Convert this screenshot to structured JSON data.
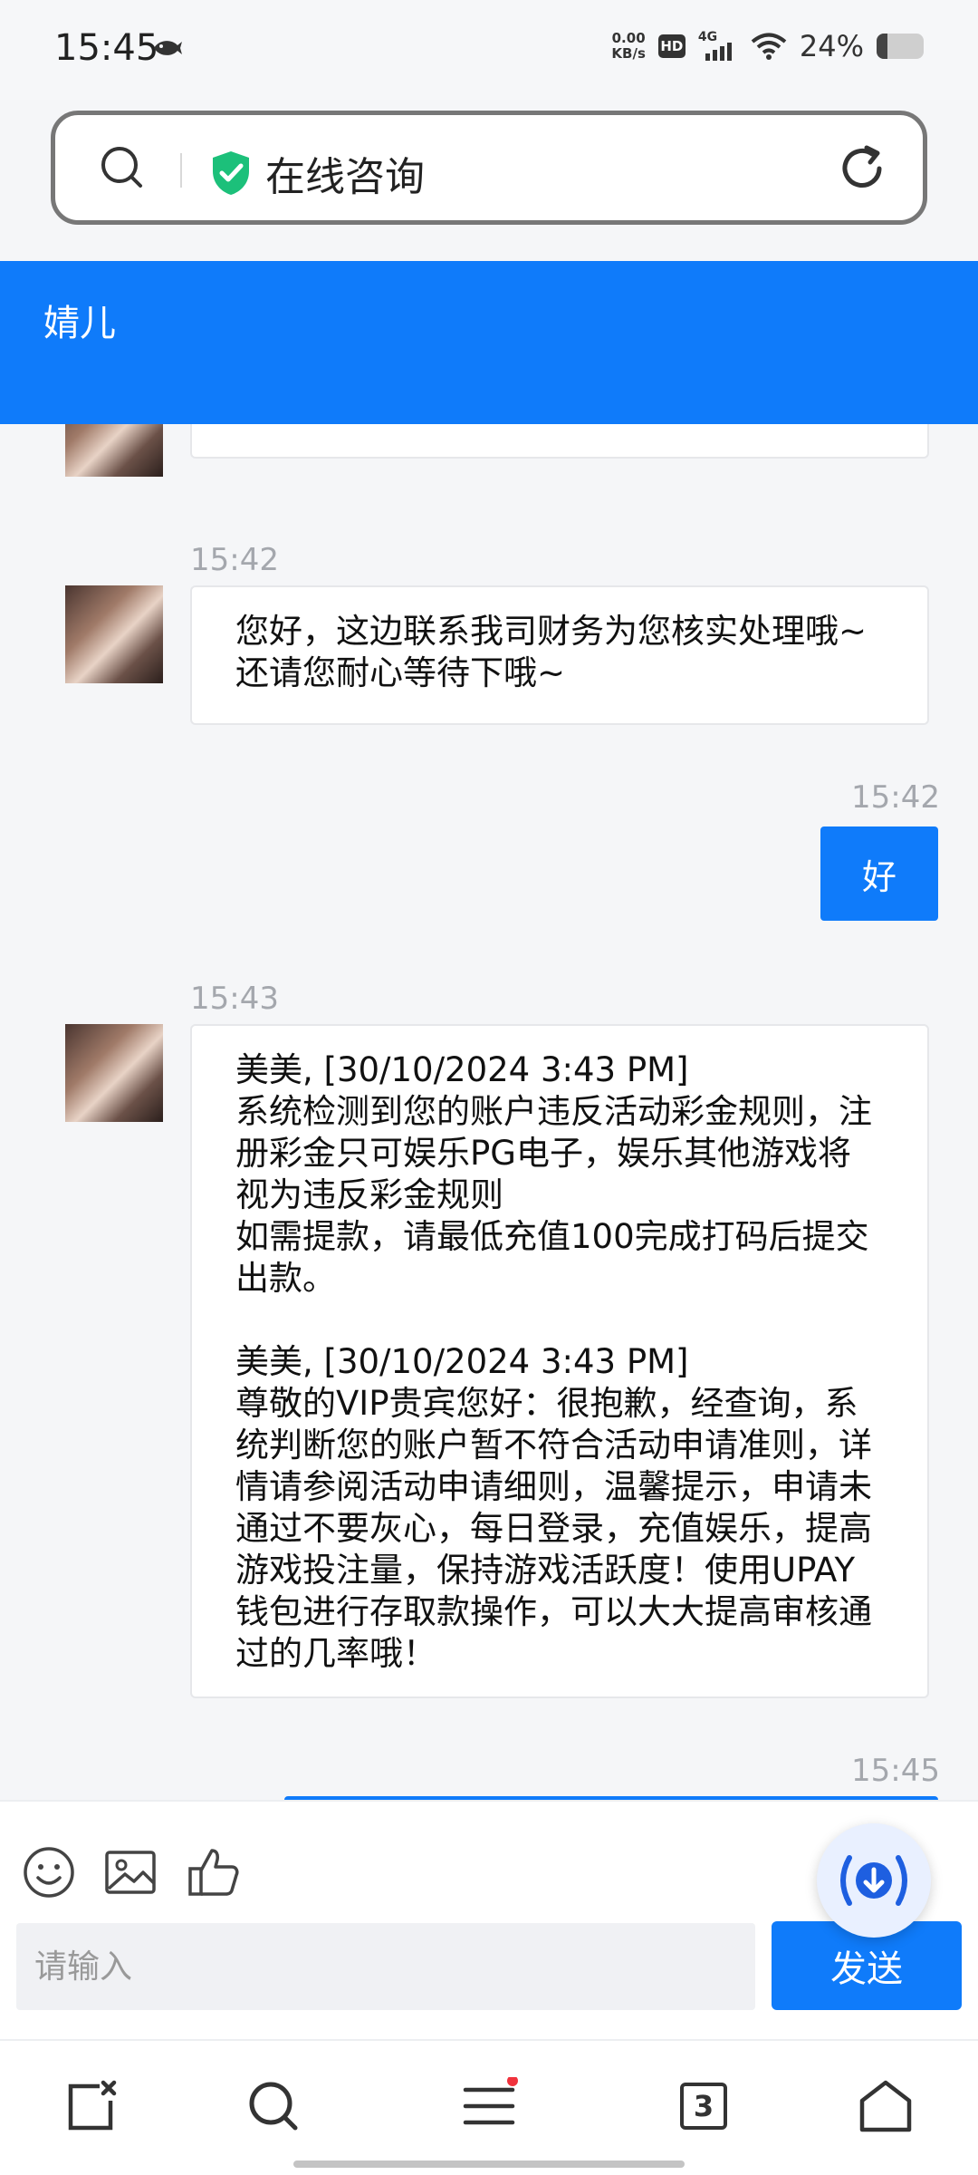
{
  "status_bar": {
    "time": "15:45",
    "net_speed_value": "0.00",
    "net_speed_unit": "KB/s",
    "hd": "HD",
    "network": "4G",
    "battery": "24%"
  },
  "search_bar": {
    "title": "在线咨询"
  },
  "chat_header": {
    "agent_name": "婧儿"
  },
  "messages": [
    {
      "text": "~"
    },
    {
      "time": "15:42",
      "text": "您好，这边联系我司财务为您核实处理哦~还请您耐心等待下哦~"
    },
    {
      "time": "15:42",
      "text": "好"
    },
    {
      "time": "15:43",
      "text": "美美, [30/10/2024 3:43 PM]\n系统检测到您的账户违反活动彩金规则，注册彩金只可娱乐PG电子，娱乐其他游戏将视为违反彩金规则\n如需提款，请最低充值100完成打码后提交出款。\n\n美美, [30/10/2024 3:43 PM]\n尊敬的VIP贵宾您好：很抱歉，经查询，系统判断您的账户暂不符合活动申请准则，详情请参阅活动申请细则，温馨提示，申请未通过不要灰心，每日登录，充值娱乐，提高游戏投注量，保持游戏活跃度！使用UPAY钱包进行存取款操作，可以大大提高审核通过的几率哦！"
    },
    {
      "time": "15:45"
    }
  ],
  "input": {
    "placeholder": "请输入",
    "send_label": "发送"
  },
  "nav": {
    "tab_count": "3"
  },
  "colors": {
    "primary": "#0f7bfa",
    "shield": "#1cc07a"
  }
}
